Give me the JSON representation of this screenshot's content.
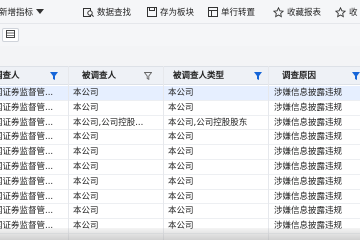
{
  "toolbar": {
    "new_indicator": "新增指标",
    "data_search": "数据查找",
    "save_board": "存为板块",
    "single_row": "单行转置",
    "favorite": "收藏报表",
    "more": "收"
  },
  "table": {
    "headers": [
      "调查人",
      "被调查人",
      "被调查人类型",
      "调查原因"
    ],
    "rows": [
      [
        "国证券监督管...",
        "本公司",
        "本公司",
        "涉嫌信息披露违规"
      ],
      [
        "国证券监督管...",
        "本公司",
        "本公司",
        "涉嫌信息披露违规"
      ],
      [
        "国证券监督管...",
        "本公司,公司控股...",
        "本公司,公司控股股东",
        "涉嫌信息披露违规"
      ],
      [
        "国证券监督管...",
        "本公司",
        "本公司",
        "涉嫌信息披露违规"
      ],
      [
        "国证券监督管...",
        "本公司",
        "本公司",
        "涉嫌信息披露违规"
      ],
      [
        "国证券监督管...",
        "本公司",
        "本公司",
        "涉嫌信息披露违规"
      ],
      [
        "国证券监督管...",
        "本公司",
        "本公司",
        "涉嫌信息披露违规"
      ],
      [
        "国证券监督管...",
        "本公司",
        "本公司",
        "涉嫌信息披露违规"
      ],
      [
        "国证券监督管...",
        "本公司",
        "本公司",
        "涉嫌信息披露违规"
      ],
      [
        "国证券监督管...",
        "本公司",
        "本公司",
        "涉嫌信息披露违规"
      ]
    ],
    "selected_row": 0
  },
  "colors": {
    "accent": "#1565d8",
    "selected_row": "#e6efff",
    "header_bg": "#eef1f6"
  }
}
